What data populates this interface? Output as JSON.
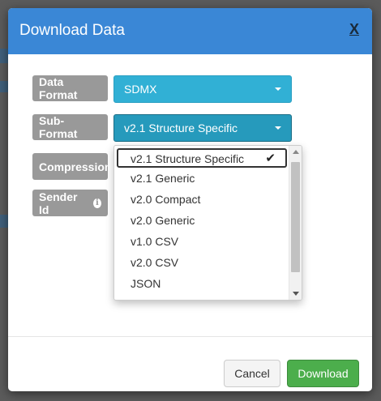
{
  "dialog": {
    "title": "Download Data",
    "close_label": "X"
  },
  "fields": {
    "data_format": {
      "label": "Data Format",
      "value": "SDMX"
    },
    "sub_format": {
      "label": "Sub-Format",
      "value": "v2.1 Structure Specific"
    },
    "compression": {
      "label": "Compression"
    },
    "sender_id": {
      "label": "Sender Id",
      "info_icon": "i"
    }
  },
  "dropdown": {
    "options": [
      "v2.1 Structure Specific",
      "v2.1 Generic",
      "v2.0 Compact",
      "v2.0 Generic",
      "v1.0 CSV",
      "v2.0 CSV",
      "JSON"
    ],
    "selected_index": 0,
    "check_glyph": "✔"
  },
  "footer": {
    "cancel_label": "Cancel",
    "download_label": "Download"
  },
  "colors": {
    "header": "#3a87d6",
    "select": "#31b0d5",
    "label": "#999999",
    "download": "#4cae4c"
  }
}
